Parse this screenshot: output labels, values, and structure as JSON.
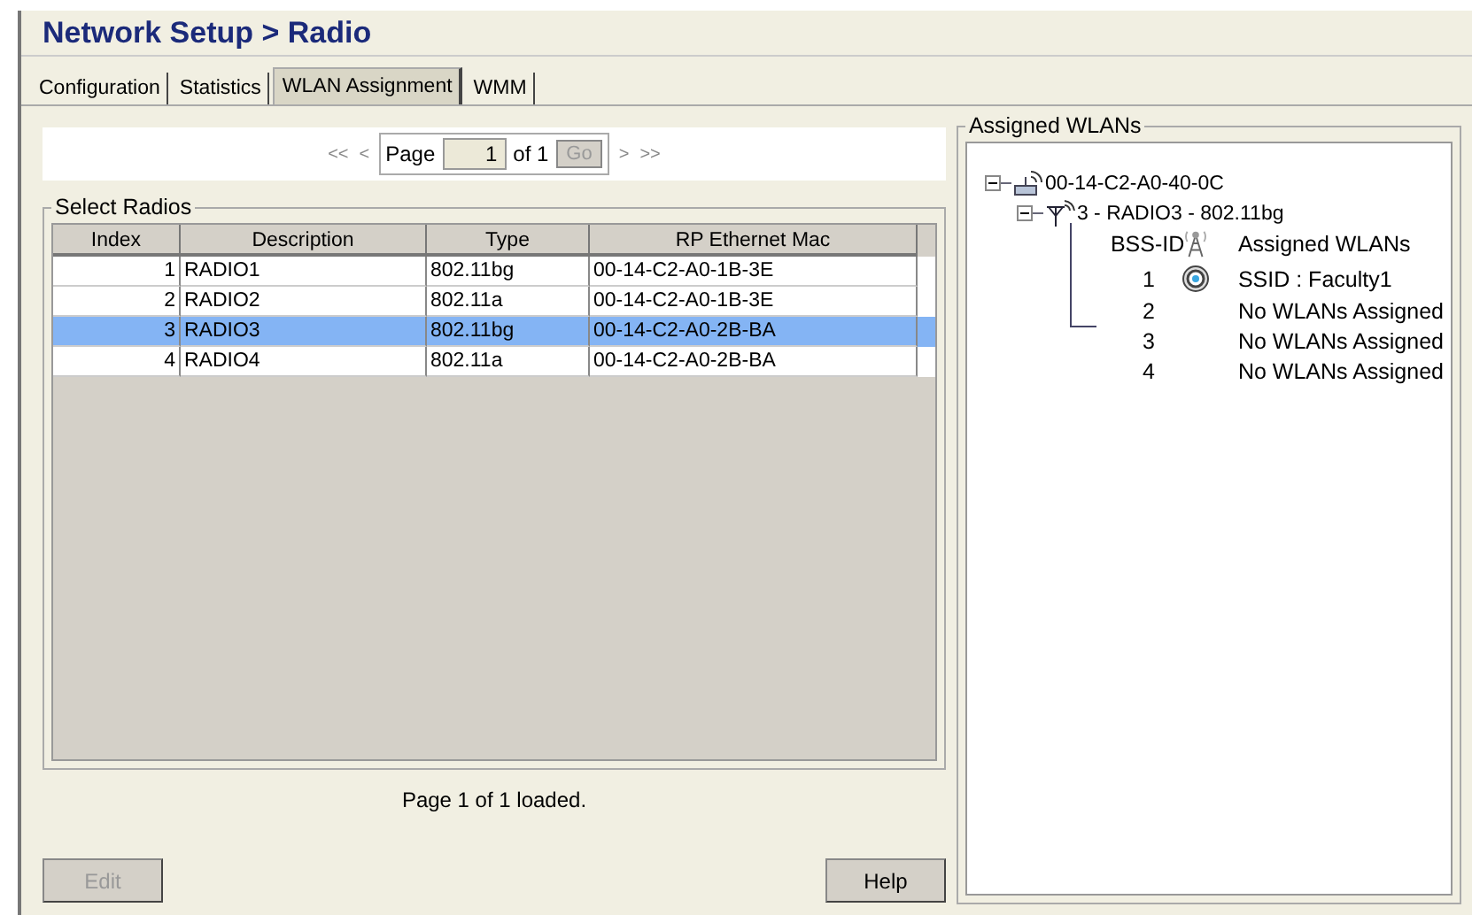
{
  "window": {
    "title": "Network Setup > Radio"
  },
  "tabs": [
    {
      "label": "Configuration",
      "selected": false
    },
    {
      "label": "Statistics",
      "selected": false
    },
    {
      "label": "WLAN Assignment",
      "selected": true
    },
    {
      "label": "WMM",
      "selected": false
    }
  ],
  "pager": {
    "first": "<<",
    "prev": "<",
    "label": "Page",
    "value": "1",
    "of": "of 1",
    "go": "Go",
    "go_disabled": true,
    "next": ">",
    "last": ">>"
  },
  "select_radios": {
    "title": "Select Radios",
    "columns": [
      "Index",
      "Description",
      "Type",
      "RP Ethernet Mac"
    ],
    "rows": [
      {
        "index": "1",
        "description": "RADIO1",
        "type": "802.11bg",
        "mac": "00-14-C2-A0-1B-3E",
        "selected": false
      },
      {
        "index": "2",
        "description": "RADIO2",
        "type": "802.11a",
        "mac": "00-14-C2-A0-1B-3E",
        "selected": false
      },
      {
        "index": "3",
        "description": "RADIO3",
        "type": "802.11bg",
        "mac": "00-14-C2-A0-2B-BA",
        "selected": true
      },
      {
        "index": "4",
        "description": "RADIO4",
        "type": "802.11a",
        "mac": "00-14-C2-A0-2B-BA",
        "selected": false
      }
    ]
  },
  "status": "Page 1 of 1 loaded.",
  "buttons": [
    {
      "label": "Edit",
      "disabled": true
    },
    {
      "label": "Help",
      "disabled": false
    }
  ],
  "assigned_wlans": {
    "title": "Assigned WLANs",
    "tree": [
      {
        "label": "00-14-C2-A0-40-0C",
        "expanded": true,
        "children": [
          {
            "label": "3 - RADIO3 - 802.11bg",
            "expanded": true
          }
        ]
      }
    ],
    "header": {
      "bss_id": "BSS-ID",
      "wlans": "Assigned WLANs"
    },
    "rows": [
      {
        "bss_id": "1",
        "wlan": "SSID : Faculty1",
        "kind": "assigned"
      },
      {
        "bss_id": "2",
        "wlan": "No WLANs Assigned",
        "kind": "none"
      },
      {
        "bss_id": "3",
        "wlan": "No WLANs Assigned",
        "kind": "none"
      },
      {
        "bss_id": "4",
        "wlan": "No WLANs Assigned",
        "kind": "none"
      }
    ]
  }
}
